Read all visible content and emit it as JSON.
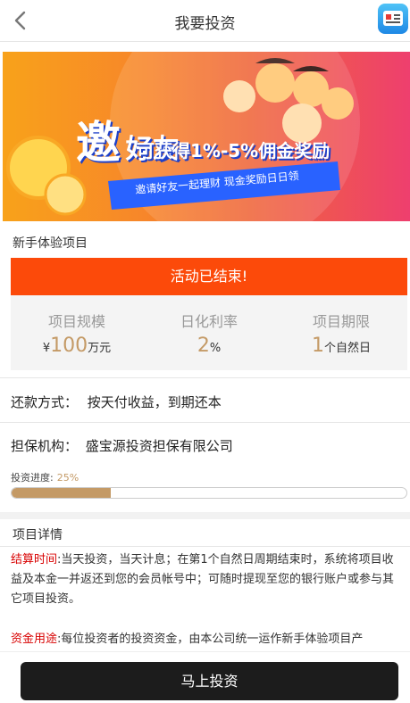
{
  "header": {
    "title": "我要投资",
    "back_icon": "chevron-left-icon",
    "app_icon": "app-shortcut-icon"
  },
  "banner": {
    "headline_char": "邀",
    "headline_rest": "好友",
    "subline": "可获得1%-5%佣金奖励",
    "ribbon": "邀请好友一起理财 现金奖励日日领"
  },
  "project": {
    "title": "新手体验项目",
    "status": "活动已结束!",
    "stats": [
      {
        "label": "项目规模",
        "prefix": "¥",
        "value": "100",
        "unit": "万元"
      },
      {
        "label": "日化利率",
        "prefix": "",
        "value": "2",
        "unit": "%"
      },
      {
        "label": "项目期限",
        "prefix": "",
        "value": "1",
        "unit": "个自然日"
      }
    ],
    "repay_label": "还款方式：",
    "repay_value": "按天付收益，到期还本",
    "guarantee_label": "担保机构：",
    "guarantee_value": "盛宝源投资担保有限公司",
    "progress_label": "投资进度:",
    "progress_pct_text": "25%",
    "progress_value": 0.25
  },
  "details": {
    "title": "项目详情",
    "p1_label": "结算时间",
    "p1_text": ":当天投资，当天计息；在第1个自然日周期结束时，系统将项目收益及本金一并返还到您的会员帐号中；可随时提现至您的银行账户或参与其它项目投资。",
    "p2_label": "资金用途",
    "p2_text": ":每位投资者的投资资金，由本公司统一运作新手体验项目产"
  },
  "footer": {
    "invest_button": "马上投资"
  },
  "colors": {
    "accent": "#fc4a0a",
    "gold": "#c49a66",
    "button_bg": "#1c1c1c"
  }
}
